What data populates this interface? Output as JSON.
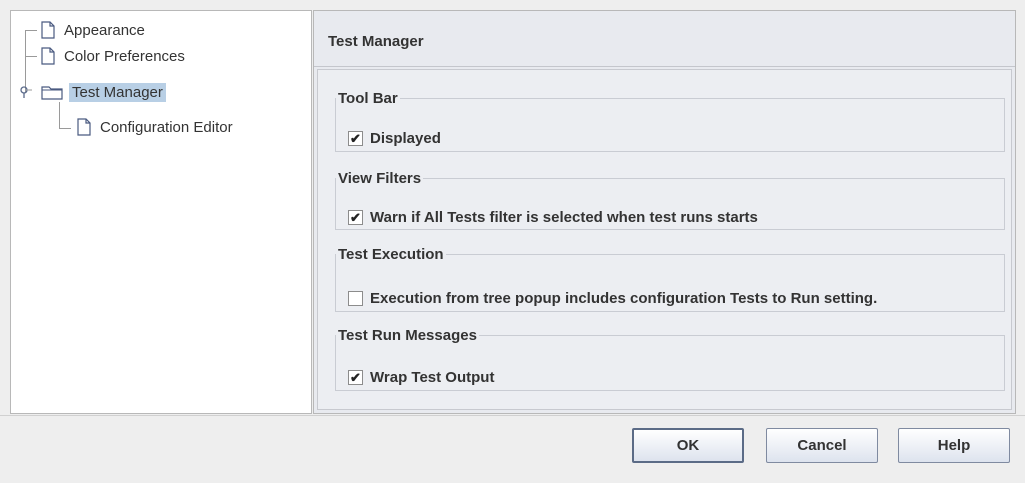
{
  "tree": {
    "items": [
      {
        "label": "Appearance",
        "icon": "document-icon"
      },
      {
        "label": "Color Preferences",
        "icon": "document-icon"
      },
      {
        "label": "Test Manager",
        "icon": "folder-icon",
        "selected": true,
        "expanded": true
      },
      {
        "label": "Configuration Editor",
        "icon": "document-icon"
      }
    ]
  },
  "panel": {
    "title": "Test Manager",
    "groups": [
      {
        "title": "Tool Bar",
        "checkbox_label": "Displayed",
        "checked": true
      },
      {
        "title": "View Filters",
        "checkbox_label": "Warn if All Tests filter is selected when test runs starts",
        "checked": true
      },
      {
        "title": "Test Execution",
        "checkbox_label": "Execution from tree popup includes configuration Tests to Run setting.",
        "checked": false
      },
      {
        "title": "Test Run Messages",
        "checkbox_label": "Wrap Test Output",
        "checked": true
      }
    ]
  },
  "buttons": {
    "ok": "OK",
    "cancel": "Cancel",
    "help": "Help"
  },
  "colors": {
    "selection": "#b8cfe5",
    "panel_bg": "#e8eaef",
    "window_bg": "#eeeeee"
  }
}
